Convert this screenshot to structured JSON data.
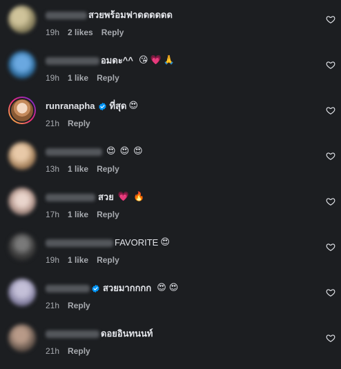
{
  "comments": [
    {
      "username": "",
      "username_blurred": true,
      "verified": false,
      "text": "สวยพร้อมฟาดดดดดด",
      "emojis": [],
      "time": "19h",
      "likes": "2 likes",
      "reply": "Reply",
      "avatar_color": "#a39a70"
    },
    {
      "username": "",
      "username_blurred": true,
      "verified": false,
      "text": "อมดะ^^",
      "emojis": [
        "😘",
        "💗",
        "🙏"
      ],
      "time": "19h",
      "likes": "1 like",
      "reply": "Reply",
      "avatar_color": "#3a7bb5"
    },
    {
      "username": "runranapha",
      "username_blurred": false,
      "verified": true,
      "text": "ที่สุด",
      "emojis": [
        "😍"
      ],
      "time": "21h",
      "likes": "",
      "reply": "Reply",
      "avatar_color": "#c48a5c"
    },
    {
      "username": "",
      "username_blurred": true,
      "verified": false,
      "text": "",
      "emojis": [
        "😍",
        "😍",
        "😍"
      ],
      "time": "13h",
      "likes": "1 like",
      "reply": "Reply",
      "avatar_color": "#b08a6a"
    },
    {
      "username": "",
      "username_blurred": true,
      "verified": false,
      "text": "สวย",
      "emojis": [
        "💗",
        "🔥"
      ],
      "time": "17h",
      "likes": "1 like",
      "reply": "Reply",
      "avatar_color": "#c9b1a8"
    },
    {
      "username": "",
      "username_blurred": true,
      "verified": false,
      "text": "FAVORITE",
      "emojis": [
        "😍"
      ],
      "time": "19h",
      "likes": "1 like",
      "reply": "Reply",
      "avatar_color": "#4a4a4a"
    },
    {
      "username": "",
      "username_blurred": true,
      "verified": true,
      "text": "สวยมากกกก",
      "emojis": [
        "😍",
        "😍"
      ],
      "time": "21h",
      "likes": "",
      "reply": "Reply",
      "avatar_color": "#8d8aa6"
    },
    {
      "username": "",
      "username_blurred": true,
      "verified": false,
      "text": "ดอยอินทนนท์",
      "emojis": [],
      "time": "21h",
      "likes": "",
      "reply": "Reply",
      "avatar_color": "#6a5a50"
    }
  ],
  "icons": {
    "like": "heart-outline-icon",
    "verified": "verified-badge-icon"
  },
  "colors": {
    "background": "#1c1e21",
    "primary_text": "#e4e6eb",
    "secondary_text": "#a8abb0",
    "verified": "#0095f6"
  }
}
